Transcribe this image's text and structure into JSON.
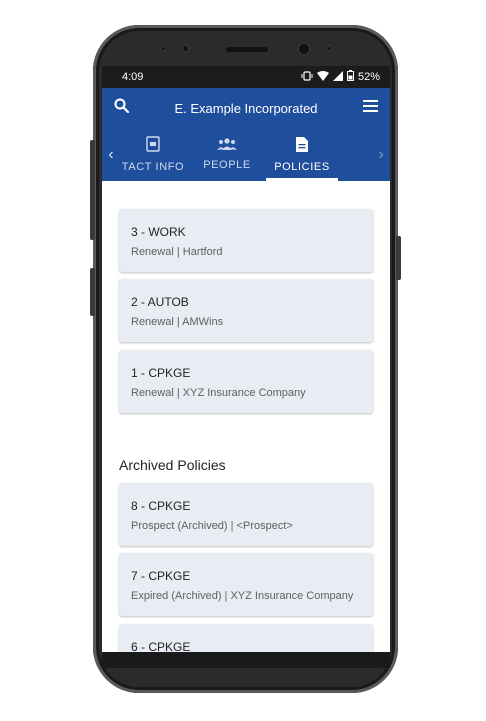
{
  "status_bar": {
    "time": "4:09",
    "battery": "52%"
  },
  "app_bar": {
    "title": "E. Example Incorporated"
  },
  "tabs": [
    {
      "label": "TACT INFO"
    },
    {
      "label": "PEOPLE"
    },
    {
      "label": "POLICIES"
    }
  ],
  "policies": [
    {
      "id": "3 - WORK",
      "detail": "Renewal | Hartford"
    },
    {
      "id": "2 - AUTOB",
      "detail": "Renewal | AMWins"
    },
    {
      "id": "1 - CPKGE",
      "detail": "Renewal | XYZ Insurance Company"
    }
  ],
  "archived": {
    "title": "Archived Policies",
    "items": [
      {
        "id": "8 - CPKGE",
        "detail": "Prospect (Archived) | <Prospect>"
      },
      {
        "id": "7 - CPKGE",
        "detail": "Expired (Archived) | XYZ Insurance Company"
      },
      {
        "id": "6 - CPKGE",
        "detail": ""
      }
    ]
  },
  "colors": {
    "primary": "#1f4e9c",
    "card": "#e8edf3"
  }
}
